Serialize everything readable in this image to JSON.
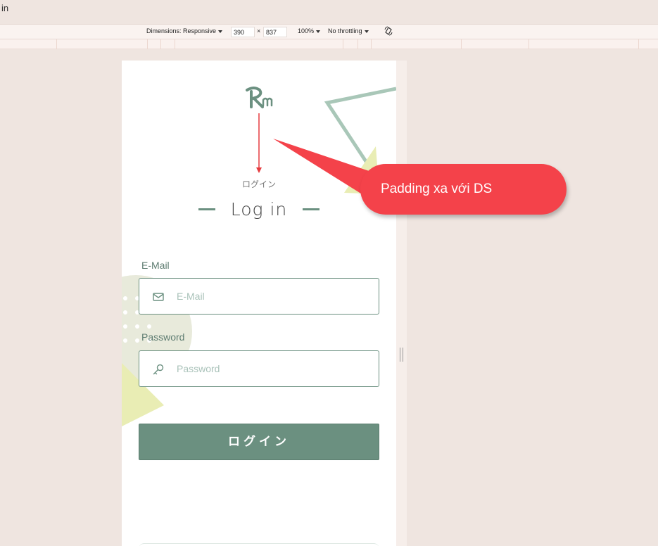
{
  "browser": {
    "tab_text": "in"
  },
  "devtools": {
    "dimensions_label": "Dimensions: Responsive",
    "width_value": "390",
    "times": "×",
    "height_value": "837",
    "zoom": "100%",
    "throttling": "No throttling"
  },
  "page": {
    "subtitle_jp": "ログイン",
    "title": "Log in",
    "email": {
      "label": "E-Mail",
      "placeholder": "E-Mail"
    },
    "password": {
      "label": "Password",
      "placeholder": "Password"
    },
    "submit_label": "ログイン"
  },
  "annotation": {
    "callout_text": "Padding xa với DS"
  },
  "colors": {
    "accent": "#6b9080",
    "callout": "#f4424a",
    "deco_yellow": "#e9edb4",
    "background": "#efe5e0"
  }
}
